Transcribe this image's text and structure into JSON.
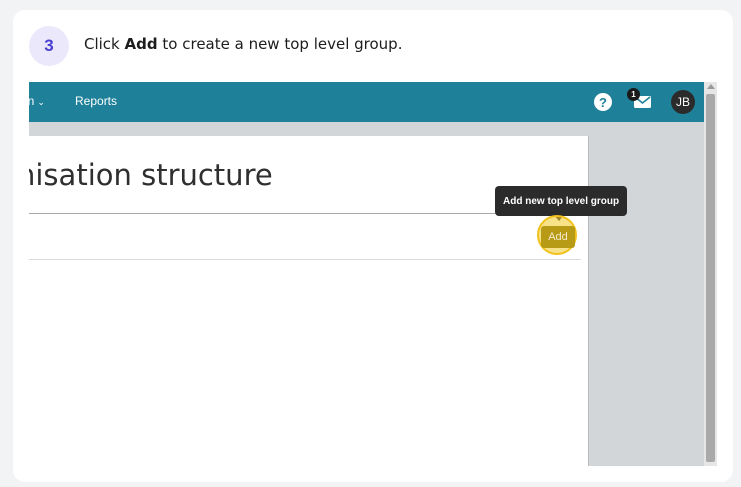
{
  "step": {
    "number": "3",
    "prefix": "Click",
    "keyword": "Add",
    "suffix": "to create a new top level group."
  },
  "app": {
    "nav": {
      "org_label": "on",
      "org_chevron": "⌄",
      "reports_label": "Reports"
    },
    "help_icon": "?",
    "mail_count": "1",
    "avatar_initials": "JB",
    "accent_color": "#1e8199"
  },
  "page": {
    "title": "nisation structure",
    "add_button_label": "Add",
    "tooltip": "Add new top level group"
  }
}
